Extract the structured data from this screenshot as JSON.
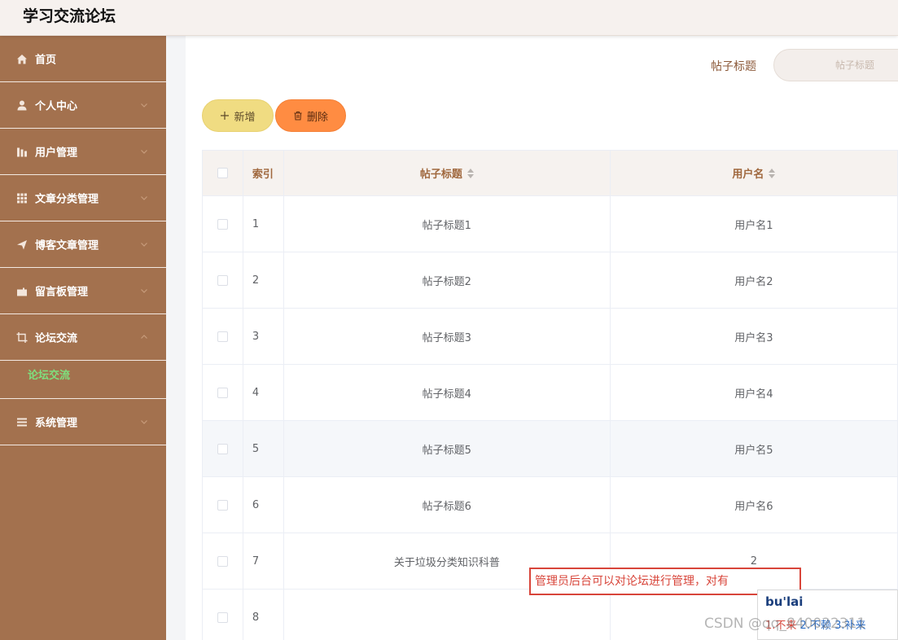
{
  "app": {
    "title": "学习交流论坛"
  },
  "sidebar": {
    "items": [
      {
        "label": "首页"
      },
      {
        "label": "个人中心"
      },
      {
        "label": "用户管理"
      },
      {
        "label": "文章分类管理"
      },
      {
        "label": "博客文章管理"
      },
      {
        "label": "留言板管理"
      },
      {
        "label": "论坛交流"
      },
      {
        "label": "系统管理"
      }
    ],
    "active_sub": "论坛交流"
  },
  "search": {
    "label": "帖子标题",
    "placeholder": "帖子标题"
  },
  "toolbar": {
    "add_label": "新增",
    "delete_label": "删除"
  },
  "table": {
    "headers": {
      "index": "索引",
      "title": "帖子标题",
      "username": "用户名"
    },
    "rows": [
      {
        "index": "1",
        "title": "帖子标题1",
        "username": "用户名1"
      },
      {
        "index": "2",
        "title": "帖子标题2",
        "username": "用户名2"
      },
      {
        "index": "3",
        "title": "帖子标题3",
        "username": "用户名3"
      },
      {
        "index": "4",
        "title": "帖子标题4",
        "username": "用户名4"
      },
      {
        "index": "5",
        "title": "帖子标题5",
        "username": "用户名5"
      },
      {
        "index": "6",
        "title": "帖子标题6",
        "username": "用户名6"
      },
      {
        "index": "7",
        "title": "关于垃圾分类知识科普",
        "username": "2"
      },
      {
        "index": "8",
        "title": "",
        "username": ""
      }
    ]
  },
  "overlay": {
    "edit_text": "管理员后台可以对论坛进行管理，对有",
    "ime_input": "bu'lai",
    "ime_candidates": [
      "1.不来",
      "2.不赖",
      "3.补来"
    ],
    "watermark": "CSDN @qq_840022311"
  }
}
